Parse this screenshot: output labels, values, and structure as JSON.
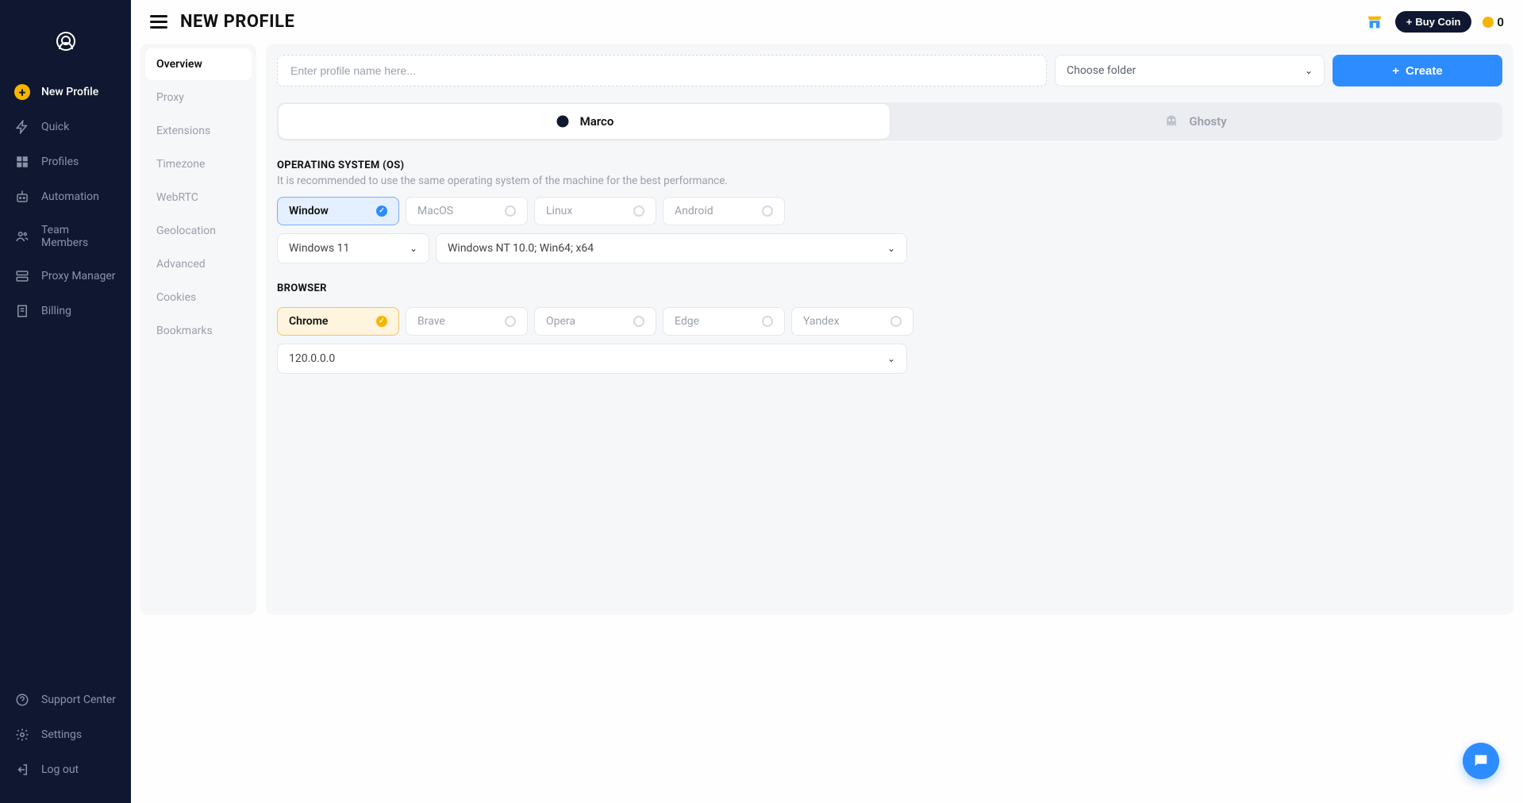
{
  "header": {
    "title": "NEW PROFILE",
    "buy_coin": "Buy Coin",
    "balance": "0"
  },
  "sidebar": {
    "items": [
      {
        "label": "New Profile"
      },
      {
        "label": "Quick"
      },
      {
        "label": "Profiles"
      },
      {
        "label": "Automation"
      },
      {
        "label": "Team Members"
      },
      {
        "label": "Proxy Manager"
      },
      {
        "label": "Billing"
      }
    ],
    "bottom": [
      {
        "label": "Support Center"
      },
      {
        "label": "Settings"
      },
      {
        "label": "Log out"
      }
    ]
  },
  "subnav": {
    "items": [
      "Overview",
      "Proxy",
      "Extensions",
      "Timezone",
      "WebRTC",
      "Geolocation",
      "Advanced",
      "Cookies",
      "Bookmarks"
    ]
  },
  "toprow": {
    "name_placeholder": "Enter profile name here...",
    "folder_label": "Choose folder",
    "create_label": "Create"
  },
  "tabs": {
    "marco": "Marco",
    "ghosty": "Ghosty"
  },
  "os": {
    "title": "OPERATING SYSTEM (OS)",
    "subtitle": "It is recommended to use the same operating system of the machine for the best performance.",
    "options": [
      "Window",
      "MacOS",
      "Linux",
      "Android"
    ],
    "version": "Windows 11",
    "ua": "Windows NT 10.0; Win64; x64"
  },
  "browser": {
    "title": "BROWSER",
    "options": [
      "Chrome",
      "Brave",
      "Opera",
      "Edge",
      "Yandex"
    ],
    "version": "120.0.0.0"
  }
}
